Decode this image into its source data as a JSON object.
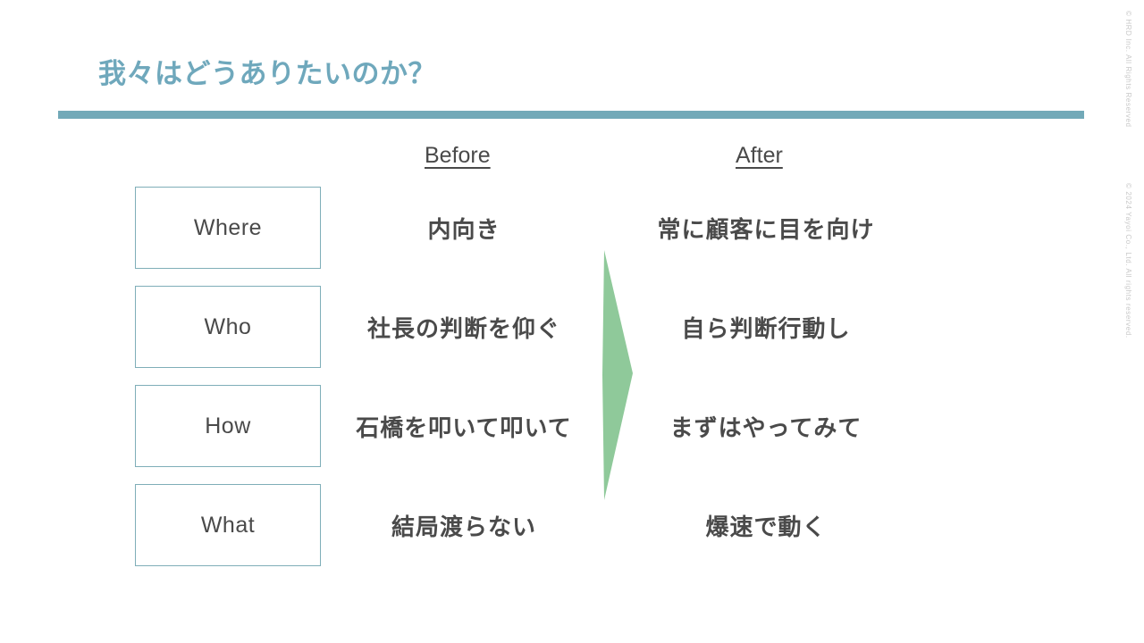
{
  "slide": {
    "title": "我々はどうありたいのか？",
    "accent_color": "#72A9B8",
    "title_color": "#6FA8BC",
    "arrow_color": "#8FC99A",
    "text_color": "#4a4a4a",
    "background": "#ffffff"
  },
  "columns": {
    "before_label": "Before",
    "after_label": "After"
  },
  "rows": [
    {
      "label": "Where",
      "before": "内向き",
      "after": "常に顧客に目を向け"
    },
    {
      "label": "Who",
      "before": "社長の判断を仰ぐ",
      "after": "自ら判断行動し"
    },
    {
      "label": "How",
      "before": "石橋を叩いて叩いて",
      "after": "まずはやってみて"
    },
    {
      "label": "What",
      "before": "結局渡らない",
      "after": "爆速で動く"
    }
  ],
  "arrow": {
    "name": "right-pointing-chevron",
    "direction": "right"
  },
  "footer": {
    "note_top": "© HRD Inc. All Rights Reserved",
    "note_bottom": "© 2024 Yayoi Co., Ltd. All rights reserved."
  }
}
